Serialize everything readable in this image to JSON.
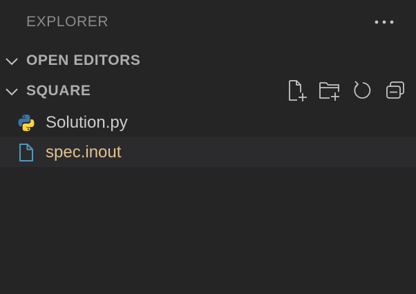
{
  "header": {
    "title": "EXPLORER",
    "more_icon": "ellipsis-icon"
  },
  "sections": {
    "open_editors": {
      "label": "OPEN EDITORS",
      "chevron_icon": "chevron-down-icon"
    },
    "workspace": {
      "label": "SQUARE",
      "chevron_icon": "chevron-down-icon",
      "actions": [
        "new-file-icon",
        "new-folder-icon",
        "refresh-icon",
        "collapse-all-icon"
      ]
    }
  },
  "files": [
    {
      "name": "Solution.py",
      "icon": "python-file-icon",
      "color": "#cccccc"
    },
    {
      "name": "spec.inout",
      "icon": "file-icon",
      "color": "#e2c08d"
    }
  ],
  "colors": {
    "background": "#252526",
    "muted_text": "#8b8b8b",
    "icon": "#c5c5c5",
    "file_icon_blue": "#519aba",
    "modified_yellow": "#e2c08d",
    "python_blue": "#3776ab",
    "python_yellow": "#ffd43b"
  }
}
